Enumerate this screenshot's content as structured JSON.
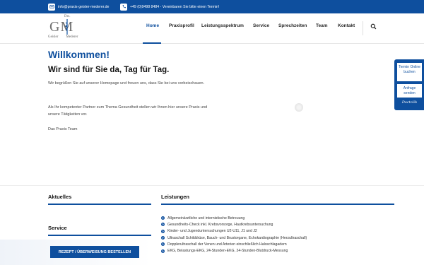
{
  "topbar": {
    "email": "info@praxis-geisler-mederer.de",
    "phone": "+49 (0)9498 8484 - Vereinbaren Sie bitte einen Termin!"
  },
  "logo": {
    "title": "Drs.",
    "mark": "GM",
    "name_left": "Geisler",
    "name_right": "Mederer"
  },
  "nav": {
    "items": [
      "Home",
      "Praxisprofil",
      "Leistungsspektrum",
      "Service",
      "Sprechzeiten",
      "Team",
      "Kontakt"
    ]
  },
  "main": {
    "heading": "Willkommen!",
    "subheading": "Wir sind für Sie da, Tag für Tag.",
    "para1": "Wir begrüßen Sie auf unserer Homepage und freuen uns, dass Sie bei uns vorbeischauen.",
    "para2": "Als Ihr kompetenter Partner zum Thema Gesundheit stellen wir Ihnen hier unsere Praxis und unsere Tätigkeiten vor.",
    "para3": "Das Praxis Team"
  },
  "widget": {
    "appointment": "Termin Online buchen",
    "request": "Anfrage senden",
    "brand": "Doctolib"
  },
  "lower": {
    "news_title": "Aktuelles",
    "service_title": "Service",
    "cta": "REZEPT / ÜBERWEISUNG BESTELLEN",
    "services_title": "Leistungen",
    "services": [
      "Allgemeinärztliche und internistische Betreuung",
      "Gesundheits-Check inkl. Krebsvorsorge, Hautkrebsuntersuchung",
      "Kinder- und Jugenduntersuchungen U2-U11, J1 und J2",
      "Ultraschall Schilddrüse, Bauch- und Brustorgane, Echokardiographie (Herzultraschall)",
      "Dopplerultraschall der Venen und Arterien einschließlich Halsschlagadern",
      "EKG, Belastungs-EKG, 24-Stunden-EKG, 24-Stunden-Blutdruck-Messung"
    ]
  },
  "colors": {
    "brand": "#0e4f9e"
  }
}
